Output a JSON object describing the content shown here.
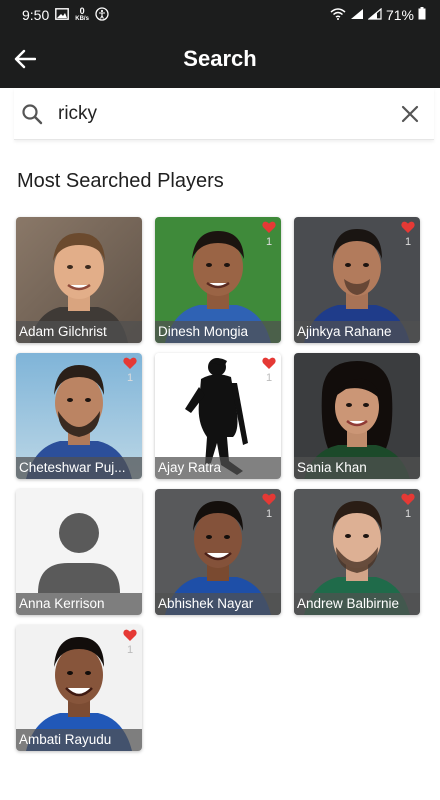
{
  "status_bar": {
    "time": "9:50",
    "speed_value": "0",
    "speed_unit": "KB/s",
    "battery": "71%"
  },
  "header": {
    "title": "Search"
  },
  "search": {
    "value": "ricky",
    "placeholder": ""
  },
  "section": {
    "title": "Most Searched Players"
  },
  "players": [
    {
      "name": "Adam Gilchrist",
      "favorite": false,
      "count": ""
    },
    {
      "name": "Dinesh Mongia",
      "favorite": true,
      "count": "1"
    },
    {
      "name": "Ajinkya Rahane",
      "favorite": true,
      "count": "1"
    },
    {
      "name": "Cheteshwar Puj...",
      "favorite": true,
      "count": "1"
    },
    {
      "name": "Ajay Ratra",
      "favorite": true,
      "count": "1"
    },
    {
      "name": "Sania Khan",
      "favorite": false,
      "count": ""
    },
    {
      "name": "Anna Kerrison",
      "favorite": false,
      "count": ""
    },
    {
      "name": "Abhishek Nayar",
      "favorite": true,
      "count": "1"
    },
    {
      "name": "Andrew Balbirnie",
      "favorite": true,
      "count": "1"
    },
    {
      "name": "Ambati Rayudu",
      "favorite": true,
      "count": "1"
    }
  ],
  "colors": {
    "app_bar": "#1c1d1d",
    "heart": "#e53935",
    "name_overlay": "#505050"
  }
}
